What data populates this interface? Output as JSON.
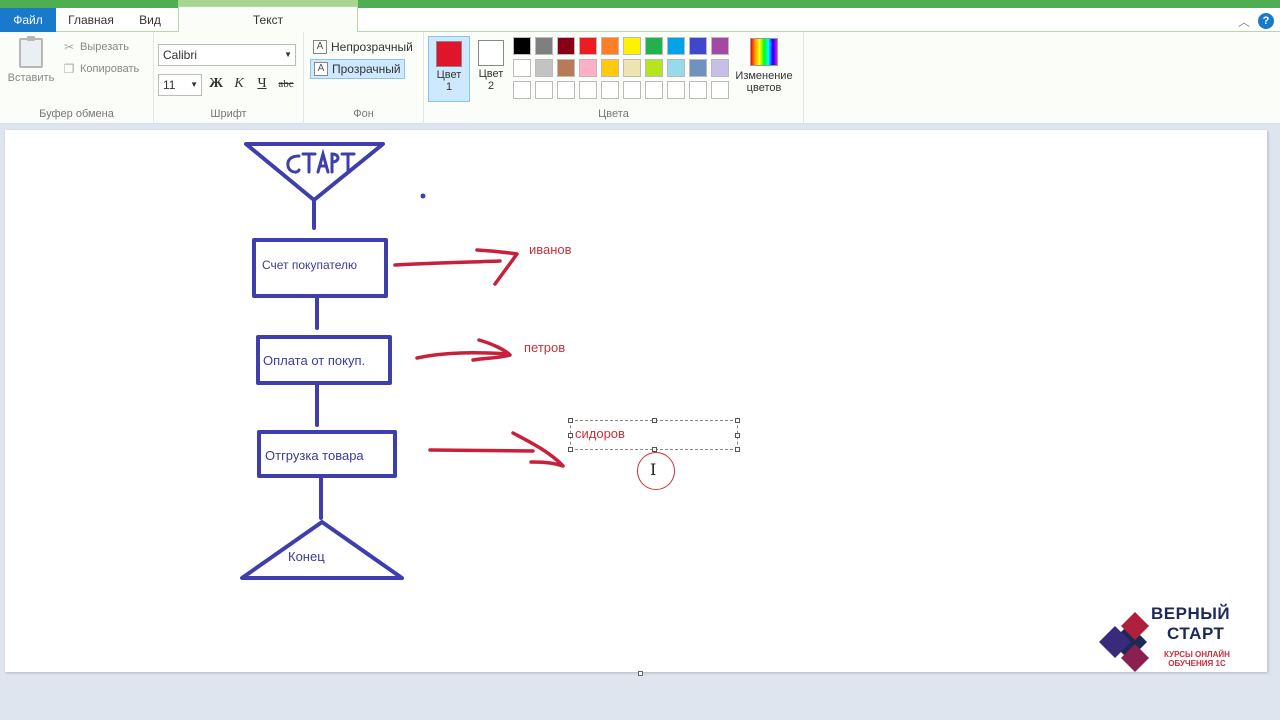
{
  "tabs": {
    "file": "Файл",
    "home": "Главная",
    "view": "Вид",
    "text": "Текст"
  },
  "clipboard": {
    "paste": "Вставить",
    "cut": "Вырезать",
    "copy": "Копировать",
    "group_label": "Буфер обмена"
  },
  "font": {
    "family": "Calibri",
    "size": "11",
    "bold": "Ж",
    "italic": "К",
    "underline": "Ч",
    "strike": "abc",
    "group_label": "Шрифт"
  },
  "background": {
    "opaque": "Непрозрачный",
    "transparent": "Прозрачный",
    "group_label": "Фон"
  },
  "colors": {
    "color1_line1": "Цвет",
    "color1_line2": "1",
    "color2_line1": "Цвет",
    "color2_line2": "2",
    "color1_value": "#e0142a",
    "color2_value": "#ffffff",
    "edit_line1": "Изменение",
    "edit_line2": "цветов",
    "group_label": "Цвета",
    "palette": [
      "#000000",
      "#7f7f7f",
      "#880015",
      "#ed1c24",
      "#ff7f27",
      "#fff200",
      "#22b14c",
      "#00a2e8",
      "#3f48cc",
      "#a349a4",
      "#ffffff",
      "#c3c3c3",
      "#b97a57",
      "#ffaec9",
      "#ffc90e",
      "#efe4b0",
      "#b5e61d",
      "#99d9ea",
      "#7092be",
      "#c8bfe7",
      "#ffffff",
      "#ffffff",
      "#ffffff",
      "#ffffff",
      "#ffffff",
      "#ffffff",
      "#ffffff",
      "#ffffff",
      "#ffffff",
      "#ffffff"
    ]
  },
  "drawing": {
    "start_label": "СТАРТ",
    "box1": "Счет покупателю",
    "box2": "Оплата от покуп.",
    "box3": "Отгрузка товара",
    "end_label": "Конец",
    "name1": "иванов",
    "name2": "петров",
    "name3": "сидоров",
    "stroke_blue": "#3e3ead",
    "stroke_red": "#c8203a"
  },
  "logo": {
    "line1": "ВЕРНЫЙ",
    "line2": "СТАРТ",
    "line3": "КУРСЫ ОНЛАЙН ОБУЧЕНИЯ 1С"
  }
}
